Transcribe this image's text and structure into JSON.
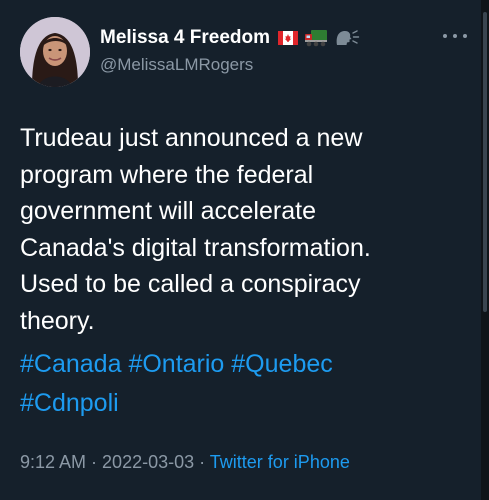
{
  "author": {
    "display_name": "Melissa 4 Freedom",
    "handle": "@MelissaLMRogers",
    "name_emojis": [
      "canada-flag-icon",
      "truck-icon",
      "speaking-head-icon"
    ]
  },
  "more_icon": "more-horizontal-icon",
  "tweet": {
    "text_lines": [
      "Trudeau just announced a new",
      "program where the federal",
      "government will accelerate",
      "Canada's digital transformation.",
      "Used to be called a conspiracy",
      "theory."
    ],
    "hashtags": [
      "#Canada",
      "#Ontario",
      "#Quebec",
      "#Cdnpoli"
    ]
  },
  "meta": {
    "time": "9:12 AM",
    "separator": " · ",
    "date": "2022-03-03",
    "source": "Twitter for iPhone"
  },
  "colors": {
    "background": "#15202b",
    "text": "#ffffff",
    "secondary_text": "#8b98a5",
    "link": "#1d9bf0"
  }
}
